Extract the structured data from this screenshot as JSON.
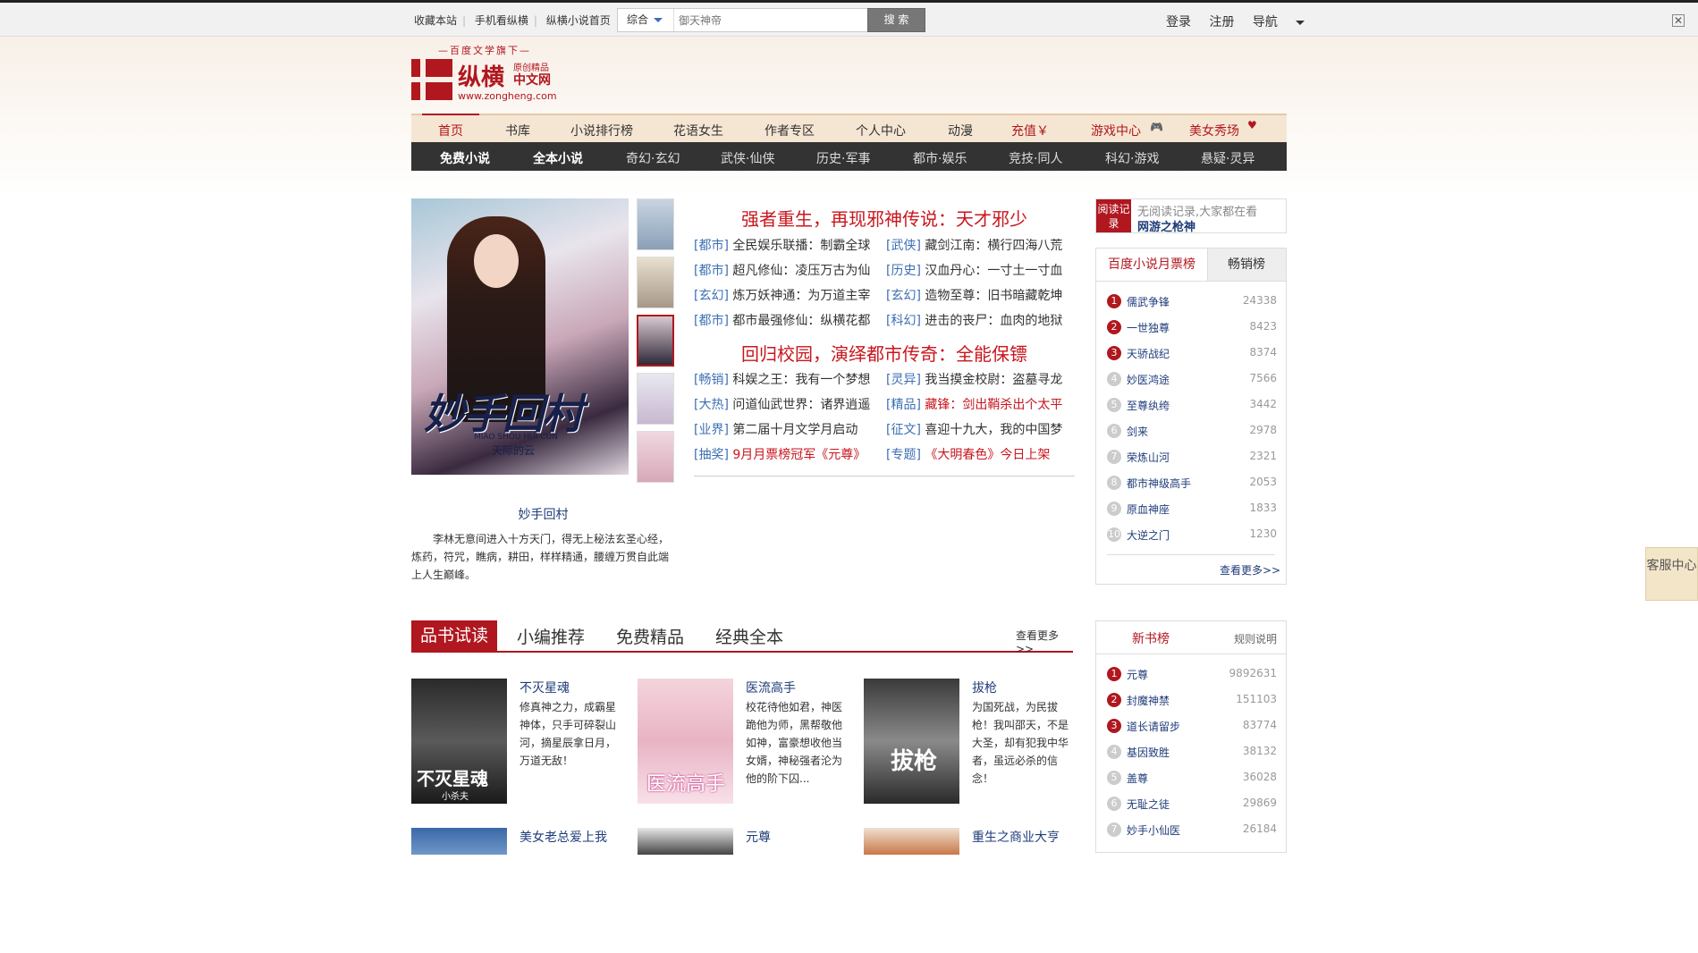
{
  "topbar": {
    "links": [
      "收藏本站",
      "手机看纵横",
      "纵横小说首页"
    ],
    "search_category": "综合",
    "search_placeholder": "御天神帝",
    "search_button": "搜 索",
    "login": "登录",
    "register": "注册",
    "nav": "导航"
  },
  "logo": {
    "tagline": "—百度文学旗下—",
    "name": "纵横",
    "sub1": "原创精品",
    "sub2": "中文网",
    "url": "www.zongheng.com"
  },
  "nav_main": [
    "首页",
    "书库",
    "小说排行榜",
    "花语女生",
    "作者专区",
    "个人中心",
    "动漫",
    "充值￥",
    "游戏中心",
    "美女秀场"
  ],
  "nav_sub": [
    "免费小说",
    "全本小说",
    "奇幻·玄幻",
    "武侠·仙侠",
    "历史·军事",
    "都市·娱乐",
    "竞技·同人",
    "科幻·游戏",
    "悬疑·灵异"
  ],
  "featured": {
    "cover_title": "妙手回村",
    "cover_pinyin": "MIAO SHOU HUI CUN",
    "cover_author": "天际的云",
    "caption": "妙手回村",
    "desc": "李林无意间进入十方天门，得无上秘法玄圣心经，炼药，符咒，瞧病，耕田，样样精通，腰缠万贯自此端上人生巅峰。"
  },
  "news": {
    "headline1": "强者重生，再现邪神传说：天才邪少",
    "group1": [
      {
        "cat": "[都市]",
        "txt": "全民娱乐联播：制霸全球"
      },
      {
        "cat": "[武侠]",
        "txt": "藏剑江南：横行四海八荒"
      },
      {
        "cat": "[都市]",
        "txt": "超凡修仙：凌压万古为仙"
      },
      {
        "cat": "[历史]",
        "txt": "汉血丹心：一寸土一寸血"
      },
      {
        "cat": "[玄幻]",
        "txt": "炼万妖神通：为万道主宰"
      },
      {
        "cat": "[玄幻]",
        "txt": "造物至尊：旧书暗藏乾坤"
      },
      {
        "cat": "[都市]",
        "txt": "都市最强修仙：纵横花都"
      },
      {
        "cat": "[科幻]",
        "txt": "进击的丧尸：血肉的地狱"
      }
    ],
    "headline2": "回归校园，演绎都市传奇：全能保镖",
    "group2": [
      {
        "cat": "[畅销]",
        "txt": "科娱之王：我有一个梦想",
        "red": false
      },
      {
        "cat": "[灵异]",
        "txt": "我当摸金校尉：盗墓寻龙",
        "red": false
      },
      {
        "cat": "[大热]",
        "txt": "问道仙武世界：诸界逍遥",
        "red": false
      },
      {
        "cat": "[精品]",
        "txt": "藏锋：剑出鞘杀出个太平",
        "red": true
      },
      {
        "cat": "[业界]",
        "txt": "第二届十月文学月启动",
        "red": false
      },
      {
        "cat": "[征文]",
        "txt": "喜迎十九大，我的中国梦",
        "red": false
      },
      {
        "cat": "[抽奖]",
        "txt": "9月月票榜冠军《元尊》",
        "red": true
      },
      {
        "cat": "[专题]",
        "txt": "《大明春色》今日上架",
        "red": true
      }
    ]
  },
  "readlog": {
    "label": "阅读记录",
    "line1": "无阅读记录,大家都在看",
    "line2": "网游之枪神"
  },
  "rank1": {
    "tab_on": "百度小说月票榜",
    "tab_off": "畅销榜",
    "items": [
      {
        "n": "1",
        "name": "儒武争锋",
        "val": "24338"
      },
      {
        "n": "2",
        "name": "一世独尊",
        "val": "8423"
      },
      {
        "n": "3",
        "name": "天骄战纪",
        "val": "8374"
      },
      {
        "n": "4",
        "name": "妙医鸿途",
        "val": "7566"
      },
      {
        "n": "5",
        "name": "至尊纨绔",
        "val": "3442"
      },
      {
        "n": "6",
        "name": "剑来",
        "val": "2978"
      },
      {
        "n": "7",
        "name": "荣炼山河",
        "val": "2321"
      },
      {
        "n": "8",
        "name": "都市神级高手",
        "val": "2053"
      },
      {
        "n": "9",
        "name": "原血神座",
        "val": "1833"
      },
      {
        "n": "10",
        "name": "大逆之门",
        "val": "1230"
      }
    ],
    "more": "查看更多>>"
  },
  "section": {
    "tabs": [
      "品书试读",
      "小编推荐",
      "免费精品",
      "经典全本"
    ],
    "more": "查看更多>>"
  },
  "books": [
    {
      "title": "不灭星魂",
      "desc": "修真神之力，成霸星神体，只手可碎裂山河，摘星辰拿日月，万道无敌！",
      "cover_text": "不灭星魂",
      "cover_author": "小杀夫"
    },
    {
      "title": "医流高手",
      "desc": "校花待他如君，神医跪他为师，黑帮敬他如神，富豪想收他当女婿，神秘强者沦为他的阶下囚...",
      "cover_text": "医流高手"
    },
    {
      "title": "拔枪",
      "desc": "为国死战，为民拔枪！我叫邵天，不是大圣，却有犯我中华者，虽远必杀的信念！",
      "cover_text": "拔枪"
    }
  ],
  "books_row2": [
    "美女老总爱上我",
    "元尊",
    "重生之商业大亨"
  ],
  "newrank": {
    "title": "新书榜",
    "rule": "规则说明",
    "items": [
      {
        "n": "1",
        "name": "元尊",
        "val": "9892631"
      },
      {
        "n": "2",
        "name": "封魔神禁",
        "val": "151103"
      },
      {
        "n": "3",
        "name": "道长请留步",
        "val": "83774"
      },
      {
        "n": "4",
        "name": "基因致胜",
        "val": "38132"
      },
      {
        "n": "5",
        "name": "盖尊",
        "val": "36028"
      },
      {
        "n": "6",
        "name": "无耻之徒",
        "val": "29869"
      },
      {
        "n": "7",
        "name": "妙手小仙医",
        "val": "26184"
      }
    ]
  },
  "kefu": "客服中心",
  "colors": {
    "brand": "#b0171f",
    "link": "#1f3c7a",
    "category": "#3c6fb4"
  }
}
